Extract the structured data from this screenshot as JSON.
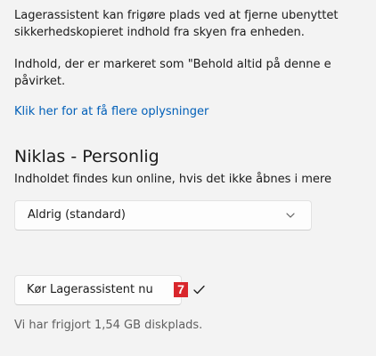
{
  "intro": {
    "line1": "Lagerassistent kan frigøre plads ved at fjerne ubenyttet",
    "line2": "sikkerhedskopieret indhold fra skyen fra enheden.",
    "line3": "Indhold, der er markeret som \"Behold altid på denne e",
    "line4": "påvirket."
  },
  "more_info_link": "Klik her for at få flere oplysninger",
  "section": {
    "title": "Niklas - Personlig",
    "description": "Indholdet findes kun online, hvis det ikke åbnes i mere"
  },
  "dropdown": {
    "selected": "Aldrig (standard)",
    "icon": "chevron-down-icon"
  },
  "run_button": {
    "label": "Kør Lagerassistent nu"
  },
  "badge": {
    "number": "7",
    "color": "#d9262c"
  },
  "status": {
    "text": "Vi har frigjort 1,54 GB diskplads.",
    "icon": "checkmark-icon"
  },
  "colors": {
    "background": "#f3f3f3",
    "link": "#005fb8",
    "text": "#1b1b1b",
    "secondary_text": "#5f5f5f"
  }
}
